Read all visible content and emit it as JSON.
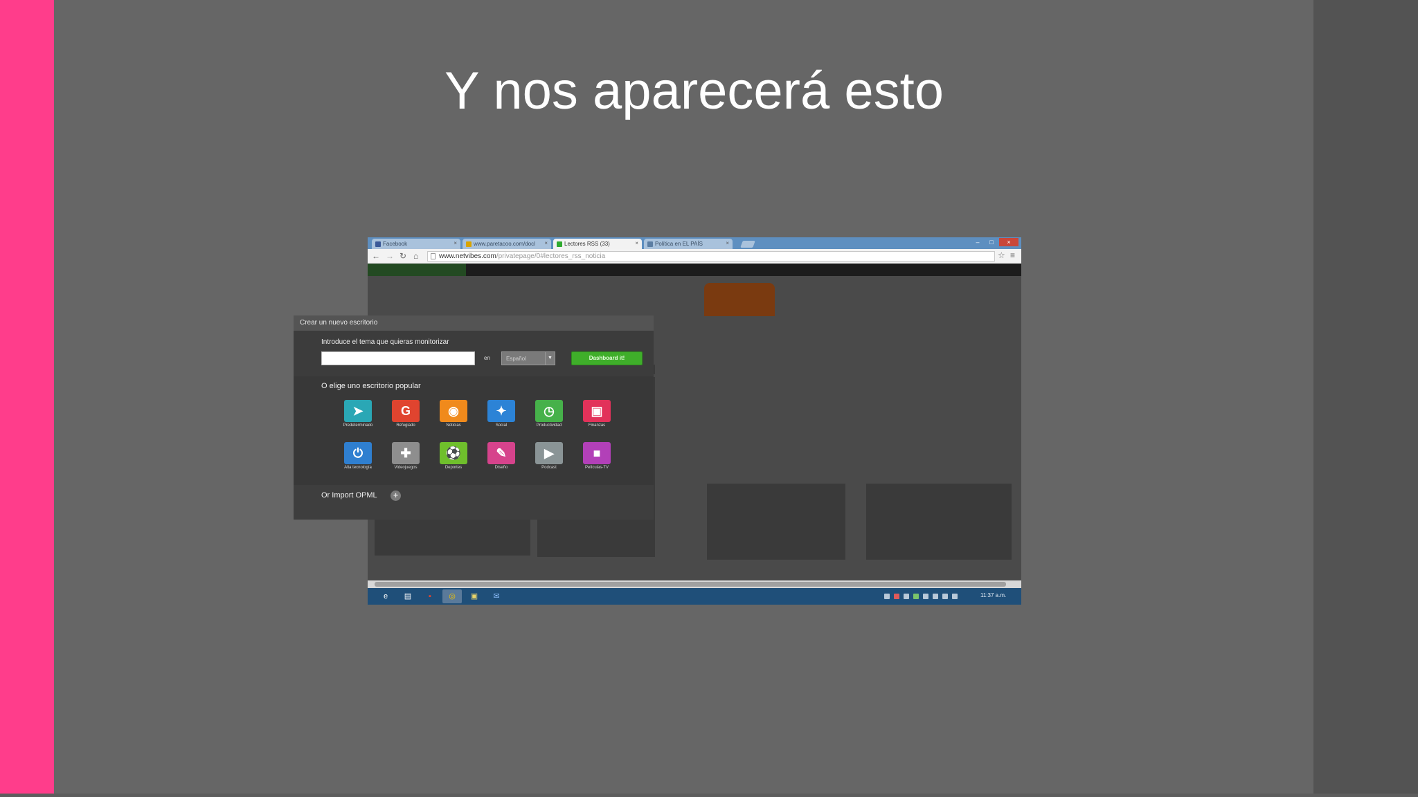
{
  "slide": {
    "title": "Y nos aparecerá esto",
    "colors": {
      "accent_bar": "#ff3d8b",
      "background": "#666666",
      "right_panel": "#535353"
    }
  },
  "browser": {
    "tabs": [
      {
        "label": "Facebook",
        "favicon_color": "#3b5998",
        "active": false
      },
      {
        "label": "www.paretacoo.com/docl",
        "favicon_color": "#d9a400",
        "active": false
      },
      {
        "label": "Lectores RSS (33)",
        "favicon_color": "#2faa2f",
        "active": true
      },
      {
        "label": "Política en EL PAÍS",
        "favicon_color": "#5c7ea3",
        "active": false
      }
    ],
    "tab_close_glyph": "×",
    "window_controls": {
      "minimize": "–",
      "maximize": "□",
      "close": "×"
    },
    "nav_icons": [
      "back-arrow-icon",
      "forward-arrow-icon",
      "reload-icon",
      "home-icon"
    ],
    "url": {
      "host": "www.netvibes.com",
      "path": "/privatepage/0#lectores_rss_noticia"
    },
    "star_glyph": "☆",
    "menu_glyph": "≡"
  },
  "modal": {
    "title": "Crear un nuevo escritorio",
    "topic_label": "Introduce el tema que quieras monitorizar",
    "topic_value": "",
    "en_label": "en",
    "language": "Español",
    "dashboard_button": "Dashboard it!",
    "popular_label": "O elige uno escritorio popular",
    "tiles": [
      {
        "label": "Predeterminado",
        "icon": "cursor-icon",
        "glyph": "➤",
        "color": "#2aa7b5"
      },
      {
        "label": "Refugiado",
        "icon": "google-icon",
        "glyph": "G",
        "color": "#e0442f"
      },
      {
        "label": "Noticias",
        "icon": "rss-icon",
        "glyph": "◉",
        "color": "#f08a1c"
      },
      {
        "label": "Social",
        "icon": "bird-icon",
        "glyph": "✦",
        "color": "#2c83d6"
      },
      {
        "label": "Productividad",
        "icon": "clock-icon",
        "glyph": "◷",
        "color": "#46b14a"
      },
      {
        "label": "Finanzas",
        "icon": "money-icon",
        "glyph": "▣",
        "color": "#e2325a"
      },
      {
        "label": "Alta tecnología",
        "icon": "power-icon",
        "glyph": "⏻",
        "color": "#2f7fd0"
      },
      {
        "label": "Videojuegos",
        "icon": "gamepad-icon",
        "glyph": "✚",
        "color": "#8e8e8e"
      },
      {
        "label": "Deportes",
        "icon": "ball-icon",
        "glyph": "⚽",
        "color": "#6fbf2c"
      },
      {
        "label": "Diseño",
        "icon": "pencil-icon",
        "glyph": "✎",
        "color": "#d6438c"
      },
      {
        "label": "Podcast",
        "icon": "play-icon",
        "glyph": "▶",
        "color": "#8a9496"
      },
      {
        "label": "Películas-TV",
        "icon": "camera-icon",
        "glyph": "■",
        "color": "#b240b8"
      }
    ],
    "opml_label": "Or Import OPML",
    "opml_plus": "+"
  },
  "taskbar": {
    "clock": "11:37 a.m.",
    "apps": [
      {
        "icon": "ie-icon",
        "glyph": "e",
        "color": "#1f4f79"
      },
      {
        "icon": "explorer-icon",
        "glyph": "▤",
        "color": "#1f4f79"
      },
      {
        "icon": "office-icon",
        "glyph": "▪",
        "color": "#1f4f79"
      },
      {
        "icon": "chrome-icon",
        "glyph": "◎",
        "color": "#5a7a9a"
      },
      {
        "icon": "notes-icon",
        "glyph": "▣",
        "color": "#1f4f79"
      },
      {
        "icon": "outlook-icon",
        "glyph": "✉",
        "color": "#1f4f79"
      }
    ]
  }
}
